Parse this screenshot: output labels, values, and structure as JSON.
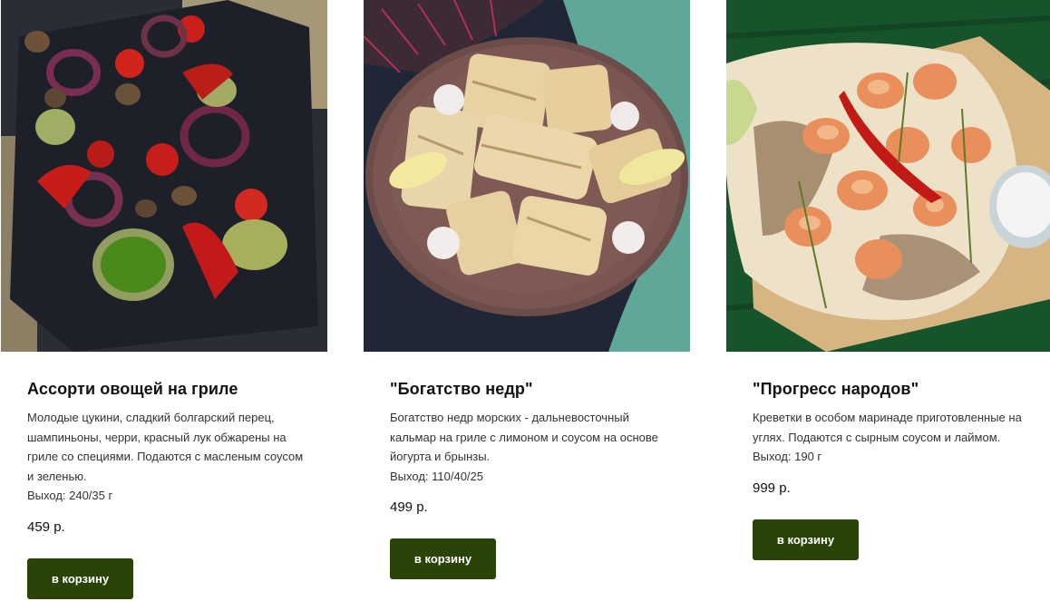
{
  "products": [
    {
      "title": "Ассорти овощей на гриле",
      "description": "Молодые цукини, сладкий болгарский перец, шампиньоны, черри, красный лук обжарены на гриле со специями. Подаются с масленым соусом и зеленью.",
      "weight": "Выход: 240/35 г",
      "price": "459 р.",
      "button": "в корзину",
      "image": "grilled-vegetables-photo"
    },
    {
      "title": "\"Богатство недр\"",
      "description": "Богатство недр морских - дальневосточный кальмар на гриле с лимоном и соусом на основе йогурта и брынзы.",
      "weight": "Выход: 110/40/25",
      "price": "499 р.",
      "button": "в корзину",
      "image": "grilled-squid-photo"
    },
    {
      "title": "\"Прогресс народов\"",
      "description": "Креветки в особом маринаде приготовленные на углях. Подаются с сырным соусом и лаймом.",
      "weight": "Выход: 190 г",
      "price": "999 р.",
      "button": "в корзину",
      "image": "grilled-shrimp-photo"
    }
  ],
  "colors": {
    "button_bg": "#2a4306",
    "button_text": "#ffffff",
    "title_text": "#111111",
    "body_text": "#333333"
  }
}
